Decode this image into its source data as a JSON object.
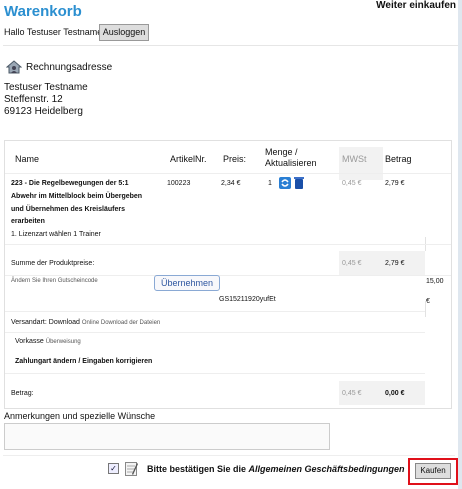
{
  "header": {
    "title": "Warenkorb",
    "continue_label": "Weiter einkaufen"
  },
  "user": {
    "greeting": "Hallo Testuser Testname",
    "logout_label": "Ausloggen"
  },
  "billing": {
    "heading": "Rechnungsadresse",
    "name": "Testuser Testname",
    "street": "Steffenstr. 12",
    "city": "69123 Heidelberg"
  },
  "table": {
    "headers": {
      "name": "Name",
      "article_no": "ArtikelNr.",
      "price": "Preis:",
      "qty": "Menge / Aktualisieren",
      "vat": "MWSt",
      "amount": "Betrag"
    },
    "items": [
      {
        "title_line1": "223 - Die Regelbewegungen der 5:1",
        "title_line2": "Abwehr im Mittelblock beim Übergeben",
        "title_line3": "und Übernehmen des Kreisläufers",
        "title_line4": "erarbeiten",
        "option": "1. Lizenzart wählen 1 Trainer",
        "article_no": "100223",
        "price": "2,34 €",
        "qty": "1",
        "vat": "0,45 €",
        "amount": "2,79 €"
      }
    ],
    "subtotal_label": "Summe der Produktpreise:",
    "subtotal_vat": "0,45 €",
    "subtotal_amount": "2,79 €",
    "voucher_label": "Ändern Sie Ihren Gutscheincode",
    "voucher_button": "Übernehmen",
    "voucher_code": "GS15211920yufEt",
    "voucher_value": "15,00",
    "voucher_currency": "€",
    "shipping_label": "Versandart:",
    "shipping_value": "Download",
    "shipping_note": "Online Download der Dateien",
    "payment_label": "Vorkasse",
    "payment_note": "Überweisung",
    "payment_change": "Zahlungart ändern / Eingaben korrigieren",
    "total_label": "Betrag:",
    "total_vat": "0,45 €",
    "total_amount": "0,00 €"
  },
  "notes": {
    "label": "Anmerkungen und spezielle Wünsche",
    "value": ""
  },
  "terms": {
    "checked_mark": "✓",
    "text_prefix": "Bitte bestätigen Sie die ",
    "text_link": "Allgemeinen Geschäftsbedingungen"
  },
  "buy_label": "Kaufen",
  "colors": {
    "title_blue": "#2b8fd0",
    "highlight_red": "#e0101a"
  },
  "icons": {
    "address": "house-person-icon",
    "refresh": "refresh-icon",
    "delete": "trash-icon",
    "pad": "notepad-icon"
  }
}
